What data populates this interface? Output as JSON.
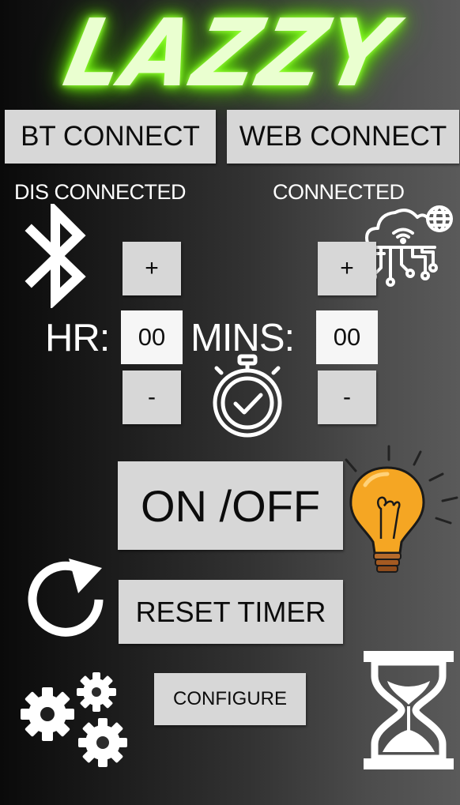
{
  "app": {
    "logo_text": "LAZZY",
    "glow_color": "#7cff1c"
  },
  "connect": {
    "bt_label": "BT CONNECT",
    "web_label": "WEB CONNECT",
    "bt_status": "DIS CONNECTED",
    "web_status": "CONNECTED"
  },
  "timer": {
    "hr_label": "HR:",
    "mins_label": "MINS:",
    "hours_value": "00",
    "minutes_value": "00",
    "increment_label": "+",
    "decrement_label": "-"
  },
  "actions": {
    "power_label": "ON /OFF",
    "reset_label": "RESET TIMER",
    "configure_label": "CONFIGURE"
  },
  "icons": {
    "bluetooth": "bluetooth-icon",
    "cloud_network": "cloud-network-icon",
    "stopwatch": "stopwatch-icon",
    "lightbulb": "lightbulb-icon",
    "refresh": "refresh-icon",
    "gears": "gears-icon",
    "hourglass": "hourglass-icon"
  },
  "colors": {
    "button_bg": "#d7d7d7",
    "bulb": "#f5a623"
  }
}
